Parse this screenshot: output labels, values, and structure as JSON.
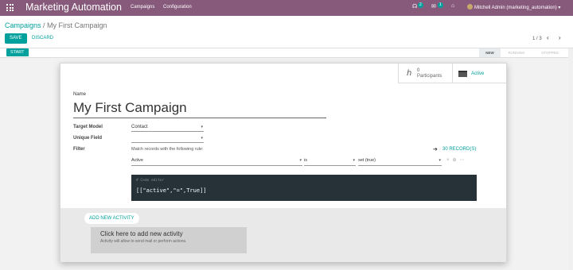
{
  "navbar": {
    "app_title": "Marketing Automation",
    "menu": [
      "Campaigns",
      "Configuration"
    ],
    "chat_count": "2",
    "activity_count": "1",
    "user": "Mitchell Admin (marketing_automation)"
  },
  "control_panel": {
    "breadcrumb_parent": "Campaigns",
    "breadcrumb_sep": " / ",
    "breadcrumb_current": "My First Campaign",
    "save_label": "SAVE",
    "discard_label": "DISCARD",
    "pager": "1 / 3"
  },
  "statusbar": {
    "start_label": "START",
    "stages": [
      "NEW",
      "RUNNING",
      "STOPPED"
    ],
    "active_stage": "NEW"
  },
  "form": {
    "participants_count": "0",
    "participants_label": "Participants",
    "active_label": "Active",
    "name_label": "Name",
    "name_value": "My First Campaign",
    "target_model_label": "Target Model",
    "target_model_value": "Contact",
    "unique_field_label": "Unique Field",
    "unique_field_value": "",
    "filter_label": "Filter",
    "filter_desc": "Match records with the following rule:",
    "records_label": "30 RECORD(S)",
    "domain_field": "Active",
    "domain_operator": "is",
    "domain_value": "set (true)",
    "code_comment": "# Code editor",
    "code_value": "[[\"active\",\"=\",True]]",
    "add_activity_label": "ADD NEW ACTIVITY",
    "helper_title": "Click here to add new activity",
    "helper_desc": "Activity will allow to send mail or perform actions."
  },
  "colors": {
    "navbar": "#875a7b",
    "accent": "#00a09d",
    "code_bg": "#263238"
  }
}
